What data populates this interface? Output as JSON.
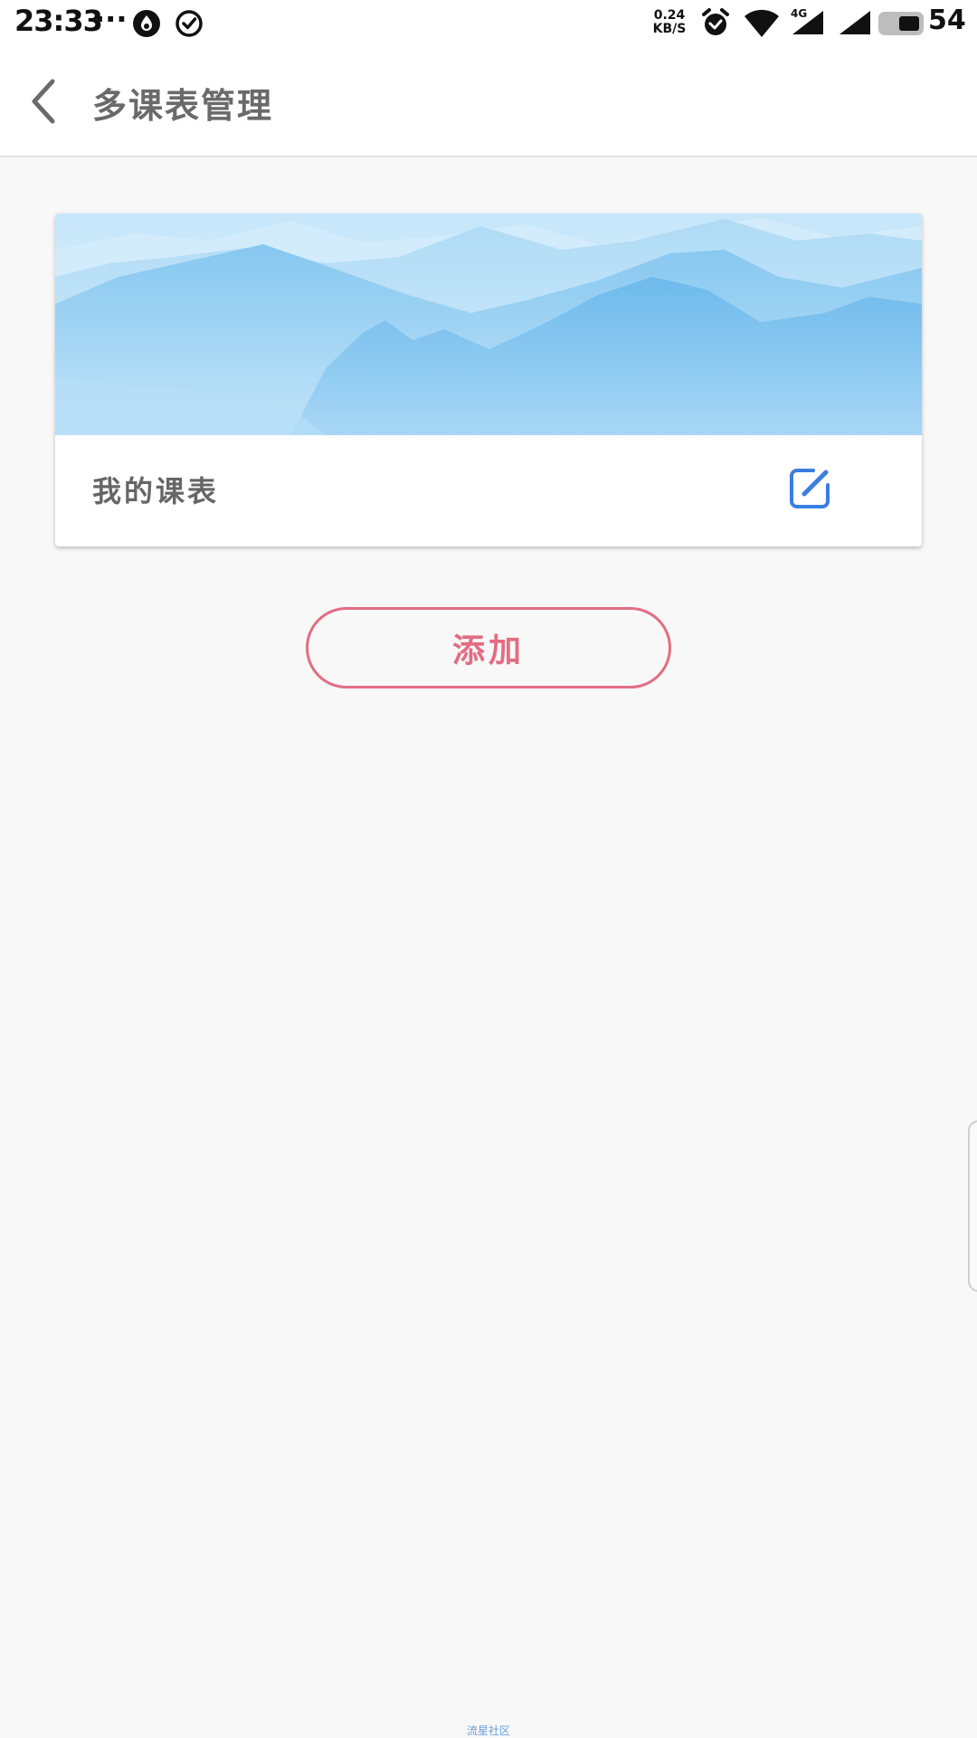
{
  "status_bar": {
    "time": "23:33",
    "more_indicator": "···",
    "network_speed_value": "0.24",
    "network_speed_unit": "KB/S",
    "network_type": "4G",
    "battery_level": "54",
    "icons": [
      "notification-app-icon",
      "check-circle-icon",
      "alarm-icon",
      "wifi-icon",
      "signal-icon",
      "signal-icon",
      "battery-icon"
    ]
  },
  "app_bar": {
    "back_icon": "chevron-left-icon",
    "title": "多课表管理"
  },
  "schedules": [
    {
      "name": "我的课表",
      "banner": "mountain-landscape",
      "edit_icon": "edit-icon"
    }
  ],
  "actions": {
    "add_label": "添加"
  },
  "watermark": "流星社区",
  "colors": {
    "accent_pink": "#e26d83",
    "edit_blue": "#3a7ee0",
    "title_gray": "#6a6a6a",
    "background": "#f8f8f8"
  }
}
